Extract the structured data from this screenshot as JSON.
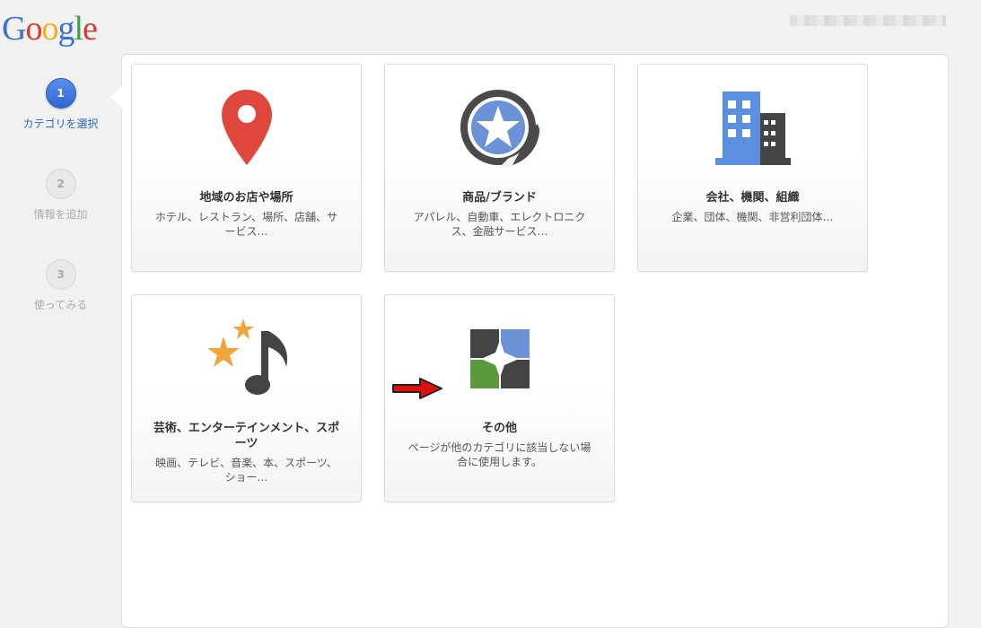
{
  "logo": {
    "letters": [
      "G",
      "o",
      "o",
      "g",
      "l",
      "e"
    ]
  },
  "steps": [
    {
      "number": "1",
      "label": "カテゴリを選択",
      "state": "active"
    },
    {
      "number": "2",
      "label": "情報を追加",
      "state": "inactive"
    },
    {
      "number": "3",
      "label": "使ってみる",
      "state": "inactive"
    }
  ],
  "cards": [
    {
      "title": "地域のお店や場所",
      "desc": "ホテル、レストラン、場所、店舗、サービス…",
      "icon": "map-pin-icon",
      "color": "#e0473c"
    },
    {
      "title": "商品/ブランド",
      "desc": "アパレル、自動車、エレクトロニクス、金融サービス…",
      "icon": "star-badge-icon",
      "color": "#6b91d6"
    },
    {
      "title": "会社、機関、組織",
      "desc": "企業、団体、機関、非営利団体…",
      "icon": "buildings-icon",
      "color": "#5b8fe0"
    },
    {
      "title": "芸術、エンターテインメント、スポーツ",
      "desc": "映画、テレビ、音楽、本、スポーツ、ショー…",
      "icon": "music-stars-icon",
      "color": "#f1a43a"
    },
    {
      "title": "その他",
      "desc": "ページが他のカテゴリに該当しない場合に使用します。",
      "icon": "puzzle-icon",
      "color": "#5b9a3c"
    }
  ]
}
